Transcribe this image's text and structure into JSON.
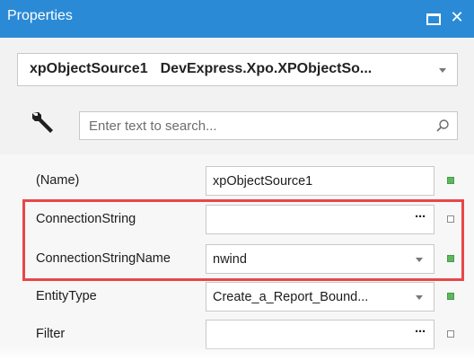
{
  "window": {
    "title": "Properties"
  },
  "object_selector": {
    "name": "xpObjectSource1",
    "type": "DevExpress.Xpo.XPObjectSo..."
  },
  "search": {
    "placeholder": "Enter text to search..."
  },
  "properties": [
    {
      "name": "(Name)",
      "value": "xpObjectSource1",
      "editor": "text",
      "modified": true
    },
    {
      "name": "ConnectionString",
      "value": "",
      "editor": "ellipsis",
      "modified": false
    },
    {
      "name": "ConnectionStringName",
      "value": "nwind",
      "editor": "dropdown",
      "modified": true
    },
    {
      "name": "EntityType",
      "value": "Create_a_Report_Bound...",
      "editor": "dropdown",
      "modified": true
    },
    {
      "name": "Filter",
      "value": "",
      "editor": "ellipsis",
      "modified": false
    }
  ],
  "colors": {
    "titlebar": "#2b8ad6",
    "highlight": "#e8474a",
    "modified_marker": "#5cb85c"
  }
}
